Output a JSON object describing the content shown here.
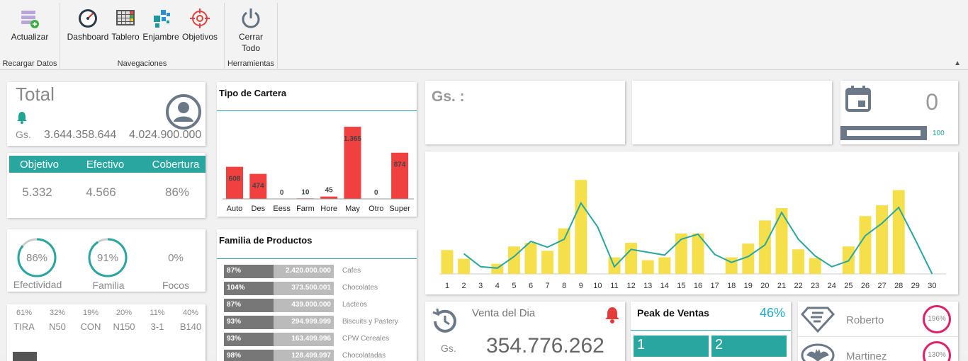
{
  "ribbon": {
    "groups": [
      {
        "label": "Recargar Datos"
      },
      {
        "label": "Navegaciones"
      },
      {
        "label": "Herramientas"
      }
    ],
    "buttons": {
      "actualizar": "Actualizar",
      "dashboard": "Dashboard",
      "tablero": "Tablero",
      "enjambre": "Enjambre",
      "objetivos": "Objetivos",
      "cerrar_line1": "Cerrar",
      "cerrar_line2": "Todo"
    },
    "collapse_icon": "chevron-up-icon"
  },
  "total": {
    "title": "Total",
    "currency": "Gs.",
    "value1": "3.644.358.644",
    "value2": "4.024.900.000",
    "icons": [
      "bell-icon",
      "user-icon"
    ]
  },
  "objetivo_table": {
    "headers": [
      "Objetivo",
      "Efectivo",
      "Cobertura"
    ],
    "values": [
      "5.332",
      "4.566",
      "86%"
    ]
  },
  "rings": {
    "efectividad": {
      "value": "86%",
      "label": "Efectividad",
      "fraction": 0.86
    },
    "familia": {
      "value": "91%",
      "label": "Familia",
      "fraction": 0.91
    },
    "focos": {
      "value": "0%",
      "label": "Focos"
    }
  },
  "product_pcts": [
    {
      "pct": "61%",
      "name": "TIRA",
      "fraction": 0.61
    },
    {
      "pct": "32%",
      "name": "N50",
      "fraction": 0.32
    },
    {
      "pct": "19%",
      "name": "CON",
      "fraction": 0.19
    },
    {
      "pct": "20%",
      "name": "N150",
      "fraction": 0.2
    },
    {
      "pct": "11%",
      "name": "3-1",
      "fraction": 0.11
    },
    {
      "pct": "40%",
      "name": "B140",
      "fraction": 0.4
    }
  ],
  "cartera": {
    "title": "Tipo de Cartera"
  },
  "familia_productos": {
    "title": "Familia de Productos",
    "rows": [
      {
        "pct": "87%",
        "value": "2.420.000.000",
        "name": "Cafes"
      },
      {
        "pct": "104%",
        "value": "373.500.001",
        "name": "Chocolates"
      },
      {
        "pct": "87%",
        "value": "439.000.000",
        "name": "Lacteos"
      },
      {
        "pct": "93%",
        "value": "294.999.999",
        "name": "Biscuits y Pastery"
      },
      {
        "pct": "93%",
        "value": "163.499.996",
        "name": "CPW Cereales"
      },
      {
        "pct": "98%",
        "value": "128.499.997",
        "name": "Chocolatadas"
      }
    ]
  },
  "gs_card": {
    "label": "Gs. :"
  },
  "calendar_card": {
    "value": "0",
    "bar_label": "100",
    "icon": "calendar-icon",
    "progress": 0.0
  },
  "venta_dia": {
    "title": "Venta del Dia",
    "currency": "Gs.",
    "value": "354.776.262",
    "icons": [
      "clock-icon",
      "alarm-bell-icon"
    ]
  },
  "peak": {
    "title": "Peak de Ventas",
    "pct": "46%",
    "tiles": [
      "1",
      "2"
    ]
  },
  "vendedores": [
    {
      "name": "Roberto",
      "pct": "196%",
      "icon": "superman-icon"
    },
    {
      "name": "Martinez",
      "pct": "130%",
      "icon": "batman-icon"
    }
  ],
  "colors": {
    "teal": "#2aa6a0",
    "red": "#f04040",
    "yellow": "#f5e04c",
    "pink": "#e0206a"
  },
  "chart_data": [
    {
      "type": "bar",
      "title": "Tipo de Cartera",
      "categories": [
        "Auto",
        "Des",
        "Eess",
        "Farm",
        "Hore",
        "May",
        "Otro",
        "Super"
      ],
      "values": [
        608,
        474,
        0,
        10,
        45,
        1365,
        0,
        874
      ],
      "labels": [
        "608",
        "474",
        "0",
        "10",
        "45",
        "1.365",
        "0",
        "874"
      ],
      "ylim": [
        0,
        1500
      ]
    },
    {
      "type": "bar",
      "categories": [
        "1",
        "2",
        "3",
        "4",
        "5",
        "6",
        "7",
        "8",
        "9",
        "10",
        "11",
        "12",
        "13",
        "14",
        "15",
        "16",
        "17",
        "18",
        "19",
        "20",
        "21",
        "22",
        "23",
        "24",
        "25",
        "26",
        "27",
        "28",
        "29",
        "30"
      ],
      "series": [
        {
          "type": "bar",
          "values": [
            33,
            21,
            0,
            14,
            38,
            43,
            32,
            63,
            130,
            0,
            23,
            43,
            19,
            23,
            56,
            56,
            0,
            23,
            42,
            74,
            91,
            34,
            22,
            0,
            38,
            80,
            95,
            116,
            0,
            0
          ]
        },
        {
          "type": "line",
          "values": [
            null,
            28,
            10,
            8,
            24,
            45,
            37,
            48,
            98,
            65,
            10,
            34,
            30,
            26,
            48,
            55,
            27,
            16,
            24,
            40,
            85,
            48,
            25,
            10,
            18,
            53,
            70,
            92,
            47,
            0
          ]
        }
      ],
      "ylim": [
        0,
        140
      ]
    }
  ]
}
